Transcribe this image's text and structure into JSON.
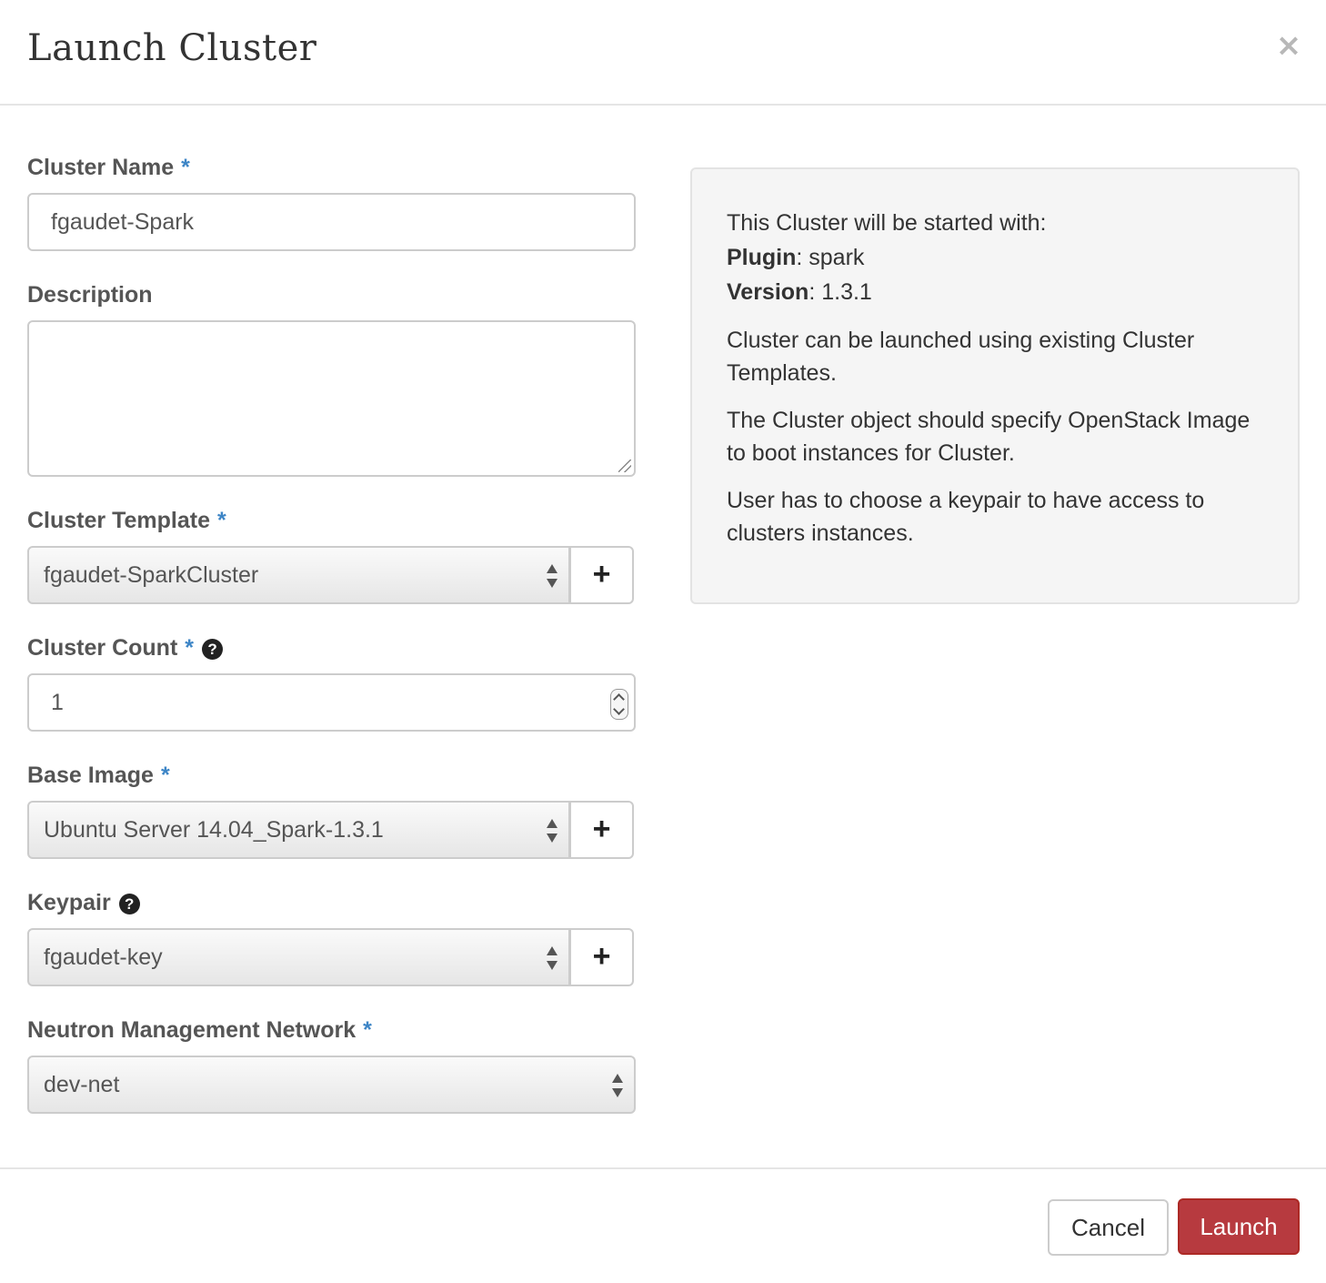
{
  "dialog": {
    "title": "Launch Cluster",
    "close_glyph": "×"
  },
  "form": {
    "cluster_name": {
      "label": "Cluster Name",
      "required": "*",
      "value": "fgaudet-Spark"
    },
    "description": {
      "label": "Description",
      "value": ""
    },
    "cluster_template": {
      "label": "Cluster Template",
      "required": "*",
      "selected": "fgaudet-SparkCluster",
      "add_glyph": "+"
    },
    "cluster_count": {
      "label": "Cluster Count",
      "required": "*",
      "help_glyph": "?",
      "value": "1"
    },
    "base_image": {
      "label": "Base Image",
      "required": "*",
      "selected": "Ubuntu Server 14.04_Spark-1.3.1",
      "add_glyph": "+"
    },
    "keypair": {
      "label": "Keypair",
      "help_glyph": "?",
      "selected": "fgaudet-key",
      "add_glyph": "+"
    },
    "neutron_network": {
      "label": "Neutron Management Network",
      "required": "*",
      "selected": "dev-net"
    }
  },
  "info": {
    "intro": "This Cluster will be started with:",
    "plugin_label": "Plugin",
    "plugin_value": ": spark",
    "version_label": "Version",
    "version_value": ": 1.3.1",
    "para1": "Cluster can be launched using existing Cluster Templates.",
    "para2": "The Cluster object should specify OpenStack Image to boot instances for Cluster.",
    "para3": "User has to choose a keypair to have access to clusters instances."
  },
  "footer": {
    "cancel_label": "Cancel",
    "launch_label": "Launch"
  },
  "colors": {
    "required_asterisk": "#3d85c6",
    "launch_button": "#b73a3f",
    "info_panel_bg": "#f5f5f5"
  }
}
